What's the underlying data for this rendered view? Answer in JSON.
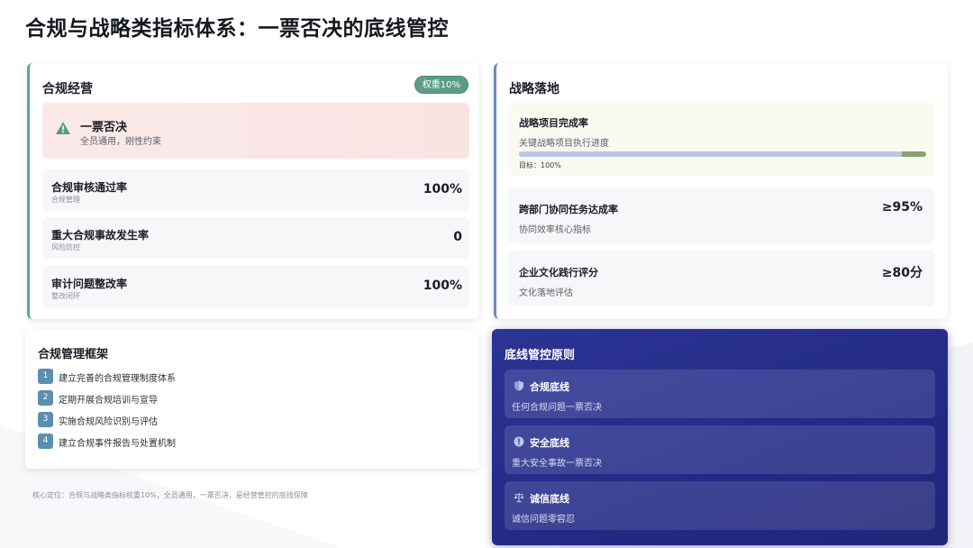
{
  "page": {
    "title": "合规与战略类指标体系：一票否决的底线管控"
  },
  "compliance": {
    "title": "合规经营",
    "weight_badge": "权重10%",
    "veto": {
      "title": "一票否决",
      "subtitle": "全员通用，刚性约束",
      "icon": "warning-triangle-icon"
    },
    "metrics": [
      {
        "name": "合规审核通过率",
        "sub": "合规管理",
        "value": "100%"
      },
      {
        "name": "重大合规事故发生率",
        "sub": "风险防控",
        "value": "0"
      },
      {
        "name": "审计问题整改率",
        "sub": "整改闭环",
        "value": "100%"
      }
    ]
  },
  "strategy": {
    "title": "战略落地",
    "goal": {
      "title": "战略项目完成率",
      "subtitle": "关键战略项目执行进度",
      "target": "目标：100%",
      "progress": 1.0
    },
    "metrics": [
      {
        "name": "跨部门协同任务达成率",
        "sub": "协同效率核心指标",
        "value": "≥95%"
      },
      {
        "name": "企业文化践行评分",
        "sub": "文化落地评估",
        "value": "≥80分"
      }
    ]
  },
  "framework": {
    "title": "合规管理框架",
    "items": [
      {
        "num": "1",
        "text": "建立完善的合规管理制度体系"
      },
      {
        "num": "2",
        "text": "定期开展合规培训与宣导"
      },
      {
        "num": "3",
        "text": "实施合规风险识别与评估"
      },
      {
        "num": "4",
        "text": "建立合规事件报告与处置机制"
      }
    ]
  },
  "core_note": "核心定位：合规与战略类指标权重10%，全员通用，一票否决，是经营管控的底线保障",
  "principles": {
    "title": "底线管控原则",
    "items": [
      {
        "name": "合规底线",
        "desc": "任何合规问题一票否决",
        "icon": "shield-icon"
      },
      {
        "name": "安全底线",
        "desc": "重大安全事故一票否决",
        "icon": "alert-circle-icon"
      },
      {
        "name": "诚信底线",
        "desc": "诚信问题零容忍",
        "icon": "scale-icon"
      }
    ]
  },
  "colors": {
    "compliance_accent": "#5aa88a",
    "strategy_accent": "#6d86c8",
    "principle_bg": "#232a86"
  }
}
